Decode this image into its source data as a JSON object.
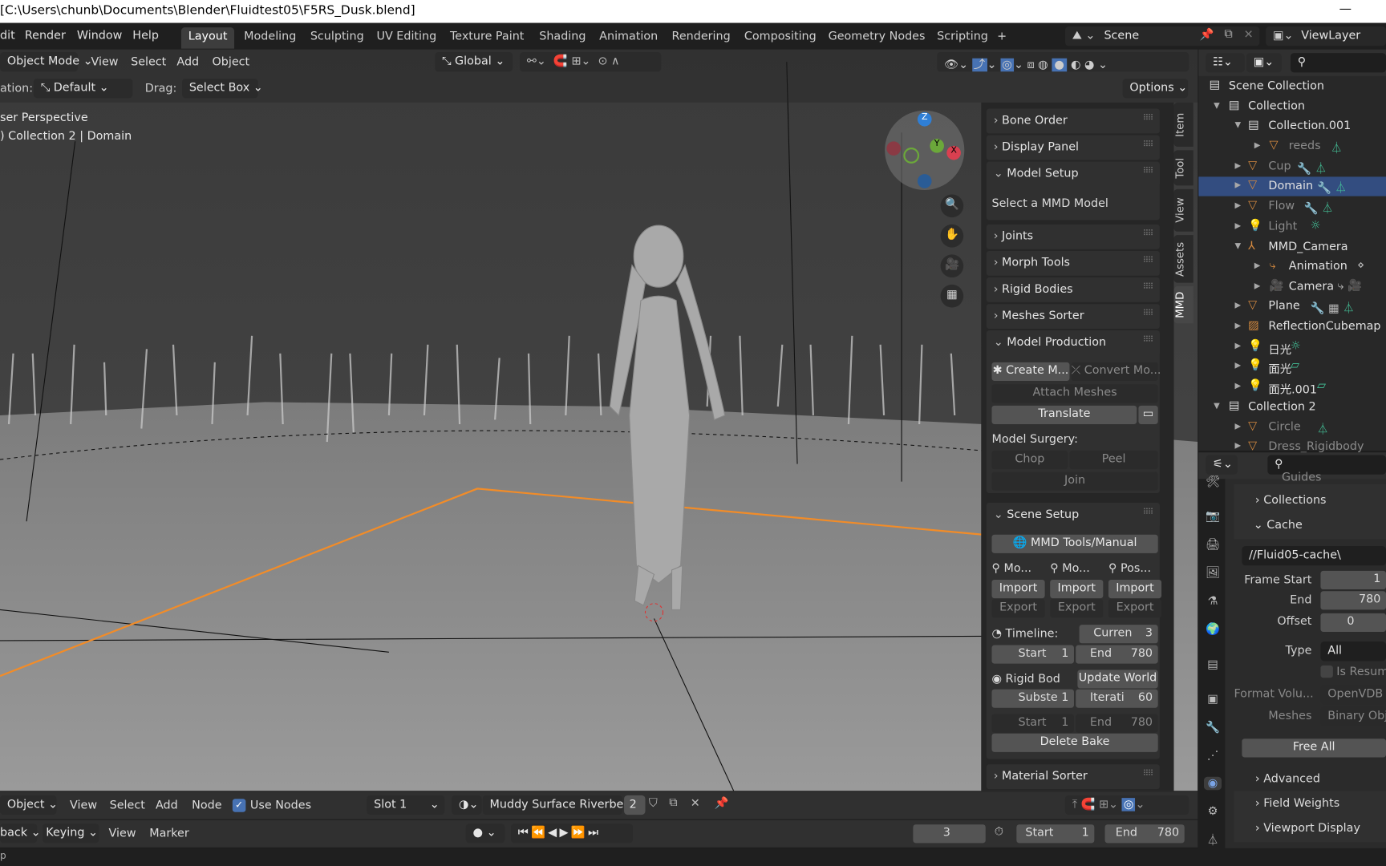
{
  "title_bar": {
    "text": "[C:\\Users\\chunb\\Documents\\Blender\\Fluidtest05\\F5RS_Dusk.blend]",
    "minimize": "—"
  },
  "menu": [
    "dit",
    "Render",
    "Window",
    "Help"
  ],
  "workspaces": [
    "Layout",
    "Modeling",
    "Sculpting",
    "UV Editing",
    "Texture Paint",
    "Shading",
    "Animation",
    "Rendering",
    "Compositing",
    "Geometry Nodes",
    "Scripting",
    "+"
  ],
  "active_workspace": "Layout",
  "scene": {
    "name": "Scene",
    "view_layer": "ViewLayer"
  },
  "viewport_header": {
    "mode": "Object Mode",
    "menus": [
      "View",
      "Select",
      "Add",
      "Object"
    ],
    "orientation": "Global"
  },
  "tool_settings": {
    "orientation_label": "ation:",
    "orientation": "Default",
    "drag_label": "Drag:",
    "drag": "Select Box",
    "options": "Options"
  },
  "viewport": {
    "perspective": "ser Perspective",
    "context": ") Collection 2 | Domain",
    "gizmo_axes": [
      "Z",
      "Y",
      "X"
    ]
  },
  "sidebar_tabs": [
    "Item",
    "Tool",
    "View",
    "Assets",
    "MMD"
  ],
  "active_sidebar_tab": "MMD",
  "mmd": {
    "bone_order": "Bone Order",
    "display_panel": "Display Panel",
    "model_setup": "Model Setup",
    "select_model": "Select a MMD Model",
    "joints": "Joints",
    "morph_tools": "Morph Tools",
    "rigid_bodies": "Rigid Bodies",
    "meshes_sorter": "Meshes Sorter",
    "model_production": "Model Production",
    "create_model": "Create M...",
    "convert_model": "Convert Mo...",
    "attach_meshes": "Attach Meshes",
    "translate": "Translate",
    "model_surgery": "Model Surgery:",
    "chop": "Chop",
    "peel": "Peel",
    "join": "Join",
    "scene_setup": "Scene Setup",
    "manual": "MMD Tools/Manual",
    "col_headers": [
      "Mo...",
      "Mo...",
      "Pos..."
    ],
    "import": "Import",
    "export": "Export",
    "timeline_label": "Timeline:",
    "current_label": "Curren",
    "current": "3",
    "start_label": "Start",
    "start": "1",
    "end_label": "End",
    "end": "780",
    "rigid_body_label": "Rigid Bod",
    "update_world": "Update World",
    "substeps_label": "Subste",
    "substeps": "1",
    "iterations_label": "Iterati",
    "iterations": "60",
    "bake_start": "1",
    "bake_end": "780",
    "delete_bake": "Delete Bake",
    "material_sorter": "Material Sorter"
  },
  "outliner": {
    "rows": [
      {
        "label": "Scene Collection",
        "icon": "scene-collection"
      },
      {
        "label": "Collection",
        "icon": "collection"
      },
      {
        "label": "Collection.001",
        "icon": "collection"
      },
      {
        "label": "reeds",
        "icon": "mesh"
      },
      {
        "label": "Cup",
        "icon": "mesh"
      },
      {
        "label": "Domain",
        "icon": "mesh",
        "selected": true
      },
      {
        "label": "Flow",
        "icon": "mesh"
      },
      {
        "label": "Light",
        "icon": "light"
      },
      {
        "label": "MMD_Camera",
        "icon": "empty"
      },
      {
        "label": "Animation",
        "icon": "action"
      },
      {
        "label": "Camera",
        "icon": "camera"
      },
      {
        "label": "Plane",
        "icon": "mesh"
      },
      {
        "label": "ReflectionCubemap",
        "icon": "lightprobe"
      },
      {
        "label": "日光",
        "icon": "light"
      },
      {
        "label": "面光",
        "icon": "light"
      },
      {
        "label": "面光.001",
        "icon": "light"
      },
      {
        "label": "Collection 2",
        "icon": "collection"
      },
      {
        "label": "Circle",
        "icon": "mesh"
      },
      {
        "label": "Dress_Rigidbody",
        "icon": "mesh"
      }
    ]
  },
  "properties": {
    "guides": "Guides",
    "collections": "Collections",
    "cache": "Cache",
    "cache_path": "//Fluid05-cache\\",
    "frame_start_label": "Frame Start",
    "frame_start": "1",
    "end_label": "End",
    "end": "780",
    "offset_label": "Offset",
    "offset": "0",
    "type_label": "Type",
    "type": "All",
    "is_resumable": "Is Resum",
    "format_volume_label": "Format Volu...",
    "format_volume": "OpenVDB",
    "meshes_label": "Meshes",
    "meshes": "Binary Obje",
    "free_all": "Free All",
    "advanced": "Advanced",
    "field_weights": "Field Weights",
    "viewport_display": "Viewport Display"
  },
  "shader_header": {
    "mode": "Object",
    "menus": [
      "View",
      "Select",
      "Add",
      "Node"
    ],
    "use_nodes": "Use Nodes",
    "use_nodes_checked": true,
    "slot": "Slot 1",
    "material": "Muddy Surface Riverbed",
    "users": "2"
  },
  "timeline_header": {
    "playback": "back",
    "keying": "Keying",
    "menus": [
      "View",
      "Marker"
    ],
    "current_frame": "3",
    "start_label": "Start",
    "start": "1",
    "end_label": "End",
    "end": "780"
  },
  "status_bar": {
    "text": "p"
  },
  "colors": {
    "selection": "#334d80",
    "accent_blue": "#4772b3",
    "object_orange": "#d58a3f",
    "data_green": "#44c49a",
    "outline_orange": "#f28c28"
  }
}
